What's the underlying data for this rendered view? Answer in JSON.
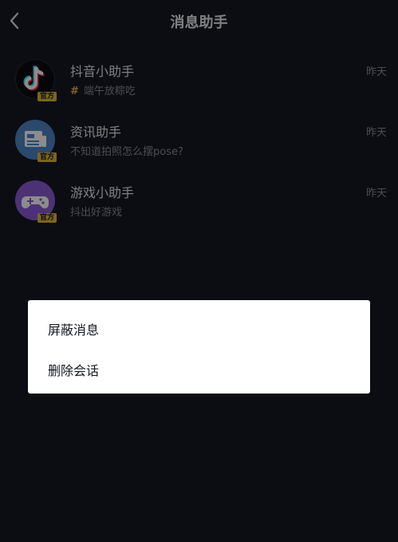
{
  "header": {
    "title": "消息助手"
  },
  "conversations": [
    {
      "name": "抖音小助手",
      "preview": "端午放粽吃",
      "time": "昨天",
      "badge": "官方"
    },
    {
      "name": "资讯助手",
      "preview": "不知道拍照怎么摆pose?",
      "time": "昨天",
      "badge": "官方"
    },
    {
      "name": "游戏小助手",
      "preview": "抖出好游戏",
      "time": "昨天",
      "badge": "官方"
    }
  ],
  "dialog": {
    "option1": "屏蔽消息",
    "option2": "删除会话"
  },
  "colors": {
    "background": "#161823",
    "badge": "#e2b93d",
    "dialog": "#ffffff"
  },
  "icons": [
    "back-arrow-icon",
    "tiktok-logo-icon",
    "news-icon",
    "gamepad-icon",
    "hashtag-icon"
  ]
}
